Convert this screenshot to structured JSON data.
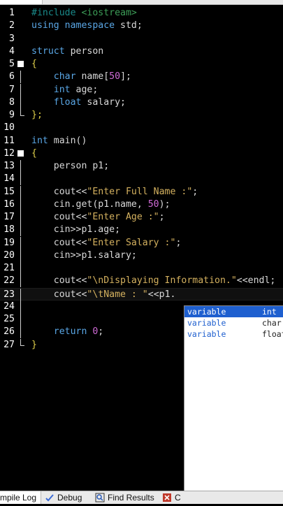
{
  "editor": {
    "lines": [
      {
        "n": "1",
        "tokens": [
          {
            "t": "#include ",
            "c": "pp"
          },
          {
            "t": "<iostream>",
            "c": "pp-inc"
          }
        ]
      },
      {
        "n": "2",
        "tokens": [
          {
            "t": "using namespace ",
            "c": "kw"
          },
          {
            "t": "std;",
            "c": "id"
          }
        ]
      },
      {
        "n": "3",
        "tokens": []
      },
      {
        "n": "4",
        "tokens": [
          {
            "t": "struct ",
            "c": "kw"
          },
          {
            "t": "person",
            "c": "id"
          }
        ]
      },
      {
        "n": "5",
        "fold": "open",
        "tokens": [
          {
            "t": "{",
            "c": "brace"
          }
        ]
      },
      {
        "n": "6",
        "fold": "line",
        "tokens": [
          {
            "t": "    char ",
            "c": "kw"
          },
          {
            "t": "name[",
            "c": "id"
          },
          {
            "t": "50",
            "c": "num"
          },
          {
            "t": "];",
            "c": "id"
          }
        ]
      },
      {
        "n": "7",
        "fold": "line",
        "tokens": [
          {
            "t": "    int ",
            "c": "kw"
          },
          {
            "t": "age;",
            "c": "id"
          }
        ]
      },
      {
        "n": "8",
        "fold": "line",
        "tokens": [
          {
            "t": "    float ",
            "c": "kw"
          },
          {
            "t": "salary;",
            "c": "id"
          }
        ]
      },
      {
        "n": "9",
        "fold": "end",
        "tokens": [
          {
            "t": "};",
            "c": "brace"
          }
        ]
      },
      {
        "n": "10",
        "tokens": []
      },
      {
        "n": "11",
        "tokens": [
          {
            "t": "int ",
            "c": "kw"
          },
          {
            "t": "main()",
            "c": "id"
          }
        ]
      },
      {
        "n": "12",
        "fold": "open",
        "tokens": [
          {
            "t": "{",
            "c": "brace"
          }
        ]
      },
      {
        "n": "13",
        "fold": "line",
        "tokens": [
          {
            "t": "    person p1;",
            "c": "id"
          }
        ]
      },
      {
        "n": "14",
        "fold": "line",
        "tokens": []
      },
      {
        "n": "15",
        "fold": "line",
        "tokens": [
          {
            "t": "    cout<<",
            "c": "id"
          },
          {
            "t": "\"Enter Full Name :\"",
            "c": "str"
          },
          {
            "t": ";",
            "c": "id"
          }
        ]
      },
      {
        "n": "16",
        "fold": "line",
        "tokens": [
          {
            "t": "    cin.get(p1.name, ",
            "c": "id"
          },
          {
            "t": "50",
            "c": "num"
          },
          {
            "t": ");",
            "c": "id"
          }
        ]
      },
      {
        "n": "17",
        "fold": "line",
        "tokens": [
          {
            "t": "    cout<<",
            "c": "id"
          },
          {
            "t": "\"Enter Age :\"",
            "c": "str"
          },
          {
            "t": ";",
            "c": "id"
          }
        ]
      },
      {
        "n": "18",
        "fold": "line",
        "tokens": [
          {
            "t": "    cin>>p1.age;",
            "c": "id"
          }
        ]
      },
      {
        "n": "19",
        "fold": "line",
        "tokens": [
          {
            "t": "    cout<<",
            "c": "id"
          },
          {
            "t": "\"Enter Salary :\"",
            "c": "str"
          },
          {
            "t": ";",
            "c": "id"
          }
        ]
      },
      {
        "n": "20",
        "fold": "line",
        "tokens": [
          {
            "t": "    cin>>p1.salary;",
            "c": "id"
          }
        ]
      },
      {
        "n": "21",
        "fold": "line",
        "tokens": []
      },
      {
        "n": "22",
        "fold": "line",
        "tokens": [
          {
            "t": "    cout<<",
            "c": "id"
          },
          {
            "t": "\"\\nDisplaying Information.\"",
            "c": "str"
          },
          {
            "t": "<<endl;",
            "c": "id"
          }
        ]
      },
      {
        "n": "23",
        "fold": "line",
        "current": true,
        "tokens": [
          {
            "t": "    cout<<",
            "c": "id"
          },
          {
            "t": "\"\\tName : \"",
            "c": "str"
          },
          {
            "t": "<<p1.",
            "c": "id"
          }
        ]
      },
      {
        "n": "24",
        "fold": "line",
        "tokens": []
      },
      {
        "n": "25",
        "fold": "line",
        "tokens": []
      },
      {
        "n": "26",
        "fold": "line",
        "tokens": [
          {
            "t": "    return ",
            "c": "kw"
          },
          {
            "t": "0",
            "c": "num"
          },
          {
            "t": ";",
            "c": "id"
          }
        ]
      },
      {
        "n": "27",
        "fold": "end",
        "tokens": [
          {
            "t": "}",
            "c": "brace"
          }
        ]
      }
    ]
  },
  "autocomplete": {
    "items": [
      {
        "kind": "variable",
        "type": "int",
        "selected": true
      },
      {
        "kind": "variable",
        "type": "char",
        "selected": false
      },
      {
        "kind": "variable",
        "type": "float",
        "selected": false
      }
    ]
  },
  "bottom_tabs": {
    "compile_log": "mpile Log",
    "debug": "Debug",
    "find_results": "Find Results",
    "close_partial": "C"
  }
}
